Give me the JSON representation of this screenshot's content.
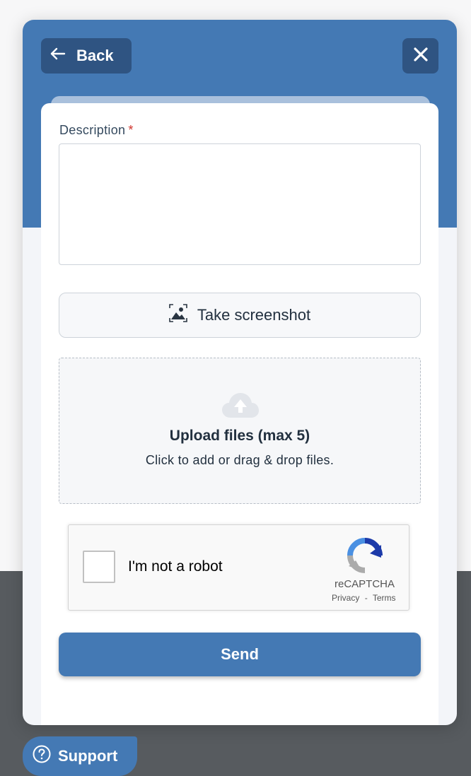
{
  "header": {
    "back_label": "Back",
    "back_icon": "arrow-left-icon",
    "close_icon": "close-icon"
  },
  "form": {
    "description_label": "Description",
    "required_marker": "*",
    "description_value": "",
    "screenshot_button_label": "Take screenshot",
    "screenshot_icon": "screenshot-icon",
    "upload_title": "Upload files (max 5)",
    "upload_subtitle": "Click to add or drag & drop files.",
    "upload_icon": "cloud-upload-icon",
    "send_label": "Send"
  },
  "recaptcha": {
    "label": "I'm not a robot",
    "brand": "reCAPTCHA",
    "privacy": "Privacy",
    "separator": "-",
    "terms": "Terms",
    "checked": false
  },
  "support": {
    "label": "Support",
    "icon": "question-circle-icon"
  },
  "colors": {
    "brand_blue": "#4479b4",
    "dark_blue": "#2f5482",
    "required_red": "#d0342c",
    "footer_gray": "#575b5f"
  }
}
